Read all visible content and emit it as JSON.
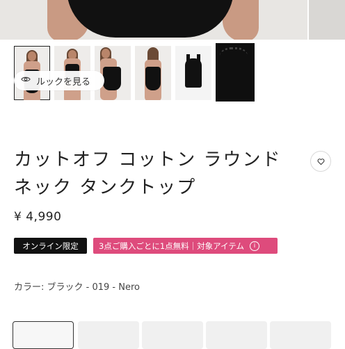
{
  "gallery": {
    "thumbnails": [
      {
        "alt": "model-front"
      },
      {
        "alt": "model-full"
      },
      {
        "alt": "model-side"
      },
      {
        "alt": "model-back"
      },
      {
        "alt": "flat-product"
      },
      {
        "alt": "fabric-detail"
      }
    ],
    "look_button_label": "ルックを見る"
  },
  "product": {
    "title_line1": "カットオフ コットン ラウンド",
    "title_line2": "ネック タンクトップ",
    "price": "¥ 4,990",
    "badge_online": "オンライン限定",
    "badge_promo": "3点ご購入ごとに1点無料｜対象アイテム",
    "color_label": "カラー: ブラック - 019 - Nero"
  },
  "colors": {
    "promo": "#de4b7c",
    "badge_dark": "#111111"
  },
  "icons": [
    "eye-icon",
    "heart-icon",
    "info-icon"
  ]
}
